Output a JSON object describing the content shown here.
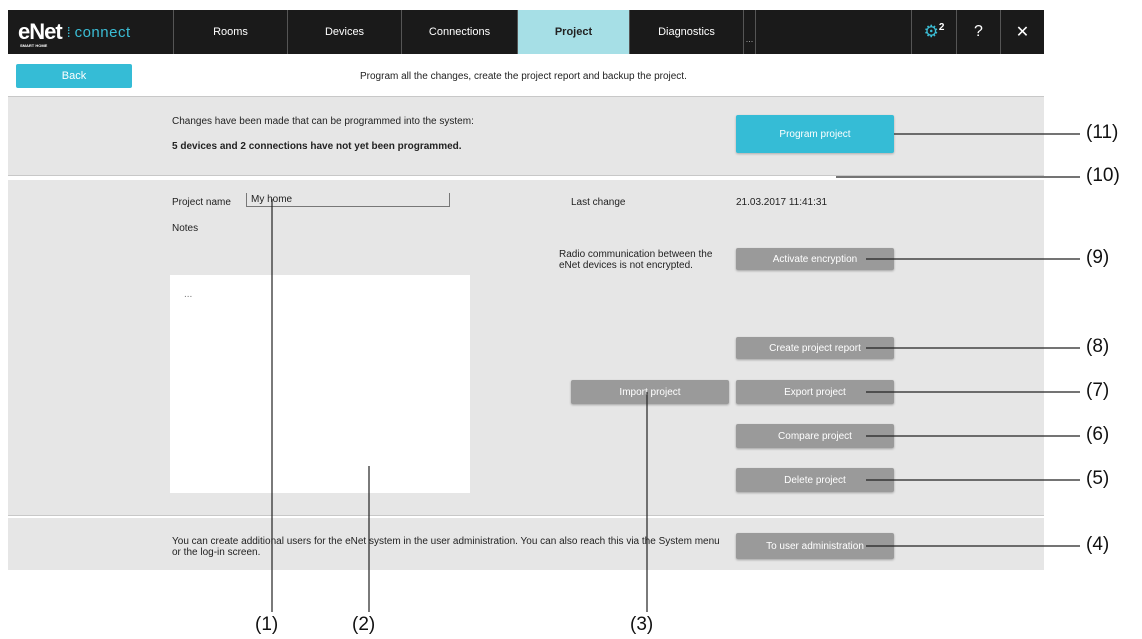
{
  "app": {
    "logo_main": "eNet",
    "logo_small": "SMART HOME",
    "logo_sub": "connect"
  },
  "nav": {
    "tabs": [
      {
        "label": "Rooms"
      },
      {
        "label": "Devices"
      },
      {
        "label": "Connections"
      },
      {
        "label": "Project",
        "active": true
      },
      {
        "label": "Diagnostics"
      }
    ],
    "more": "...",
    "settings_badge": "2",
    "help": "?",
    "close": "✕"
  },
  "header": {
    "back_label": "Back",
    "description": "Program all the changes, create the project report and backup the project."
  },
  "program": {
    "info": "Changes have been made that can be programmed into the system:",
    "status": "5 devices and 2 connections have not yet been programmed.",
    "button": "Program project"
  },
  "project": {
    "name_label": "Project name",
    "name_value": "My home",
    "notes_label": "Notes",
    "notes_placeholder": "...",
    "last_change_label": "Last change",
    "last_change_value": "21.03.2017 11:41:31",
    "encryption_text": "Radio communication between the eNet devices is not encrypted.",
    "activate_encryption": "Activate encryption",
    "create_report": "Create project report",
    "import": "Import project",
    "export": "Export project",
    "compare": "Compare project",
    "delete": "Delete project"
  },
  "users": {
    "text": "You can create additional users for the eNet system in the user administration. You can also reach this via the System menu or the log-in screen.",
    "button": "To user administration"
  },
  "callouts": {
    "c1": "(1)",
    "c2": "(2)",
    "c3": "(3)",
    "c4": "(4)",
    "c5": "(5)",
    "c6": "(6)",
    "c7": "(7)",
    "c8": "(8)",
    "c9": "(9)",
    "c10": "(10)",
    "c11": "(11)"
  },
  "colors": {
    "accent": "#35bcd6",
    "active_tab": "#a6dfe6",
    "topbar": "#1a1a1a",
    "panel": "#e6e6e6",
    "grey_button": "#9a9a9a"
  }
}
